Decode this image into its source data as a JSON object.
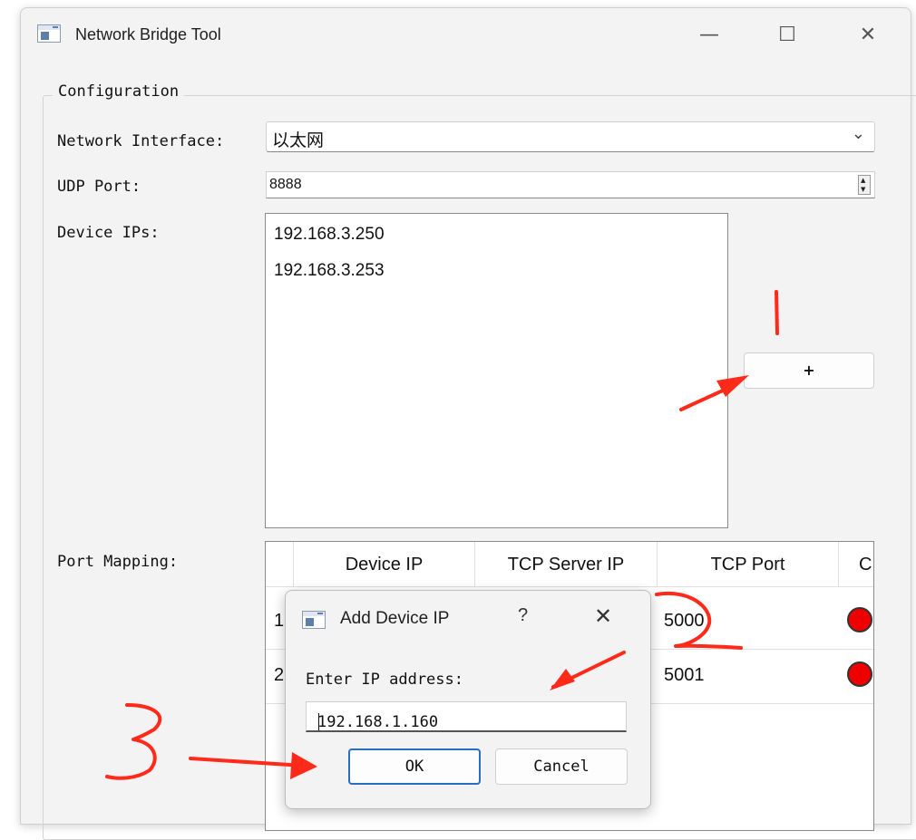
{
  "window": {
    "title": "Network Bridge Tool",
    "minimize": "—",
    "maximize": "☐",
    "close": "✕"
  },
  "config": {
    "group_title": "Configuration",
    "network_interface_label": "Network Interface:",
    "network_interface_value": "以太网",
    "udp_port_label": "UDP Port:",
    "udp_port_value": "8888",
    "device_ips_label": "Device IPs:",
    "device_ips": [
      "192.168.3.250",
      "192.168.3.253"
    ],
    "add_button_label": "+",
    "port_mapping_label": "Port Mapping:"
  },
  "table": {
    "headers": [
      "Device IP",
      "TCP Server IP",
      "TCP Port",
      "C"
    ],
    "rows": [
      {
        "index": "1",
        "tcp_port": "5000",
        "status_color": "#ee0000"
      },
      {
        "index": "2",
        "tcp_port": "5001",
        "status_color": "#ee0000"
      }
    ]
  },
  "dialog": {
    "title": "Add Device IP",
    "help": "?",
    "close": "✕",
    "prompt": "Enter IP address:",
    "input_value": "192.168.1.160",
    "ok_label": "OK",
    "cancel_label": "Cancel"
  },
  "annotations": {
    "step1": "1",
    "step2": "2",
    "step3": "3",
    "color": "#ff2a1a"
  }
}
